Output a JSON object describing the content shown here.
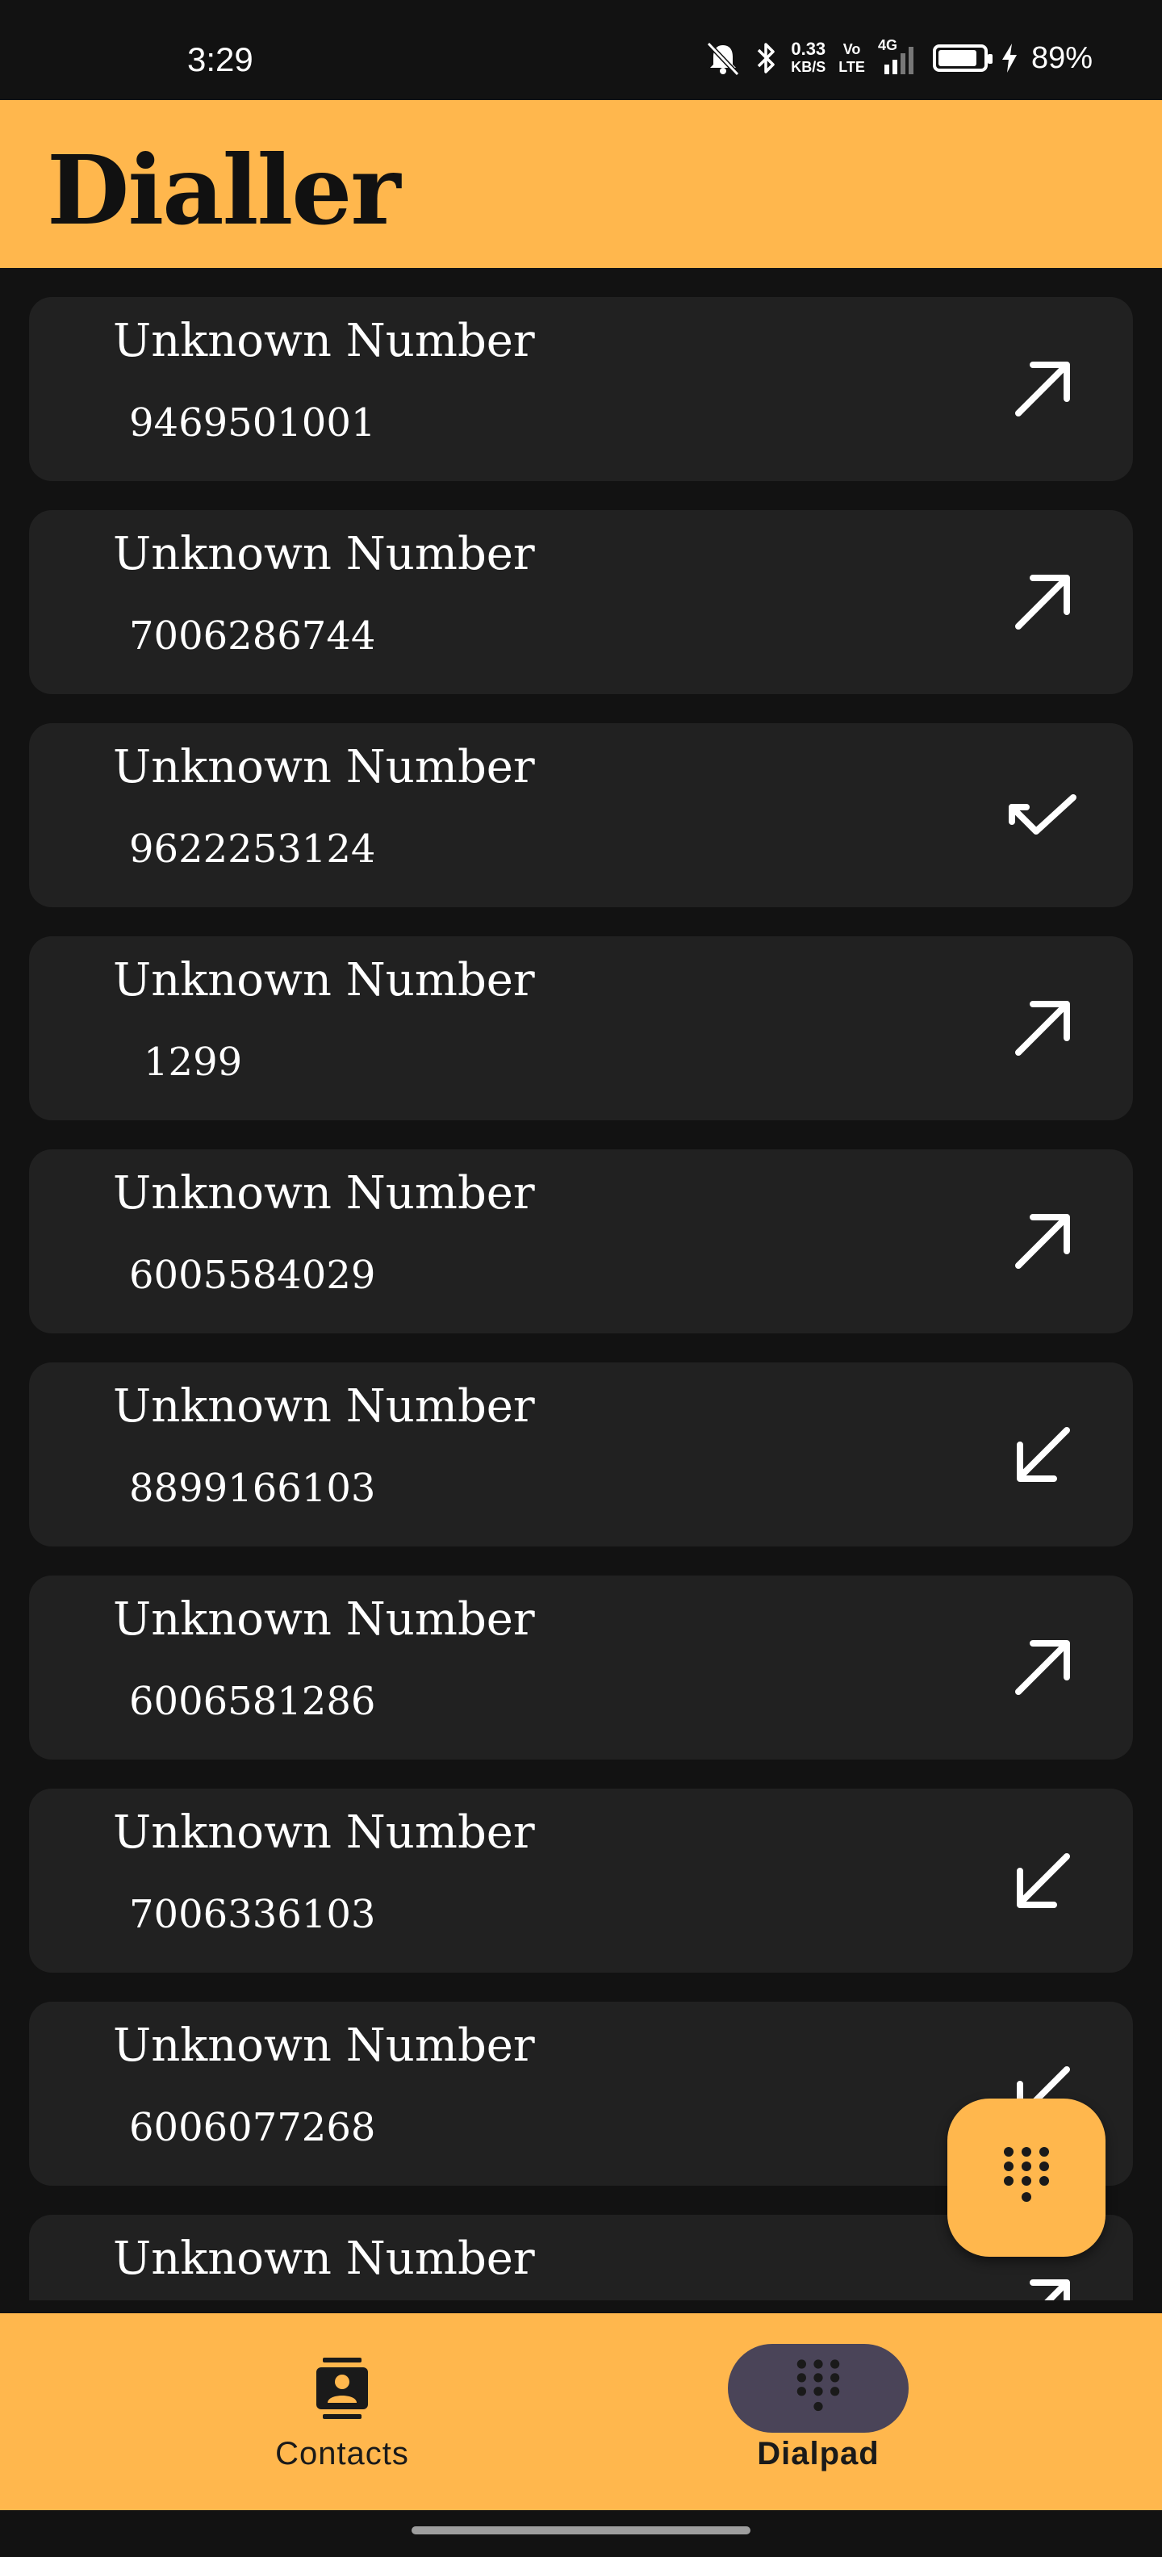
{
  "status_bar": {
    "time": "3:29",
    "net_speed_value": "0.33",
    "net_speed_unit": "KB/S",
    "volte_top": "Vo",
    "volte_bottom": "LTE",
    "network": "4G",
    "battery_text": "89%",
    "battery_level_percent": 89
  },
  "app_bar": {
    "title": "Dialler"
  },
  "calls": [
    {
      "name": "Unknown Number",
      "number": "9469501001",
      "direction": "outgoing"
    },
    {
      "name": "Unknown Number",
      "number": "7006286744",
      "direction": "outgoing"
    },
    {
      "name": "Unknown Number",
      "number": "9622253124",
      "direction": "missed"
    },
    {
      "name": "Unknown Number",
      "number": "1299",
      "direction": "outgoing"
    },
    {
      "name": "Unknown Number",
      "number": "6005584029",
      "direction": "outgoing"
    },
    {
      "name": "Unknown Number",
      "number": "8899166103",
      "direction": "incoming"
    },
    {
      "name": "Unknown Number",
      "number": "6006581286",
      "direction": "outgoing"
    },
    {
      "name": "Unknown Number",
      "number": "7006336103",
      "direction": "incoming"
    },
    {
      "name": "Unknown Number",
      "number": "6006077268",
      "direction": "incoming"
    },
    {
      "name": "Unknown Number",
      "number": "",
      "direction": "outgoing"
    }
  ],
  "fab": {
    "icon": "dialpad-icon"
  },
  "bottom_nav": {
    "items": [
      {
        "label": "Contacts",
        "icon": "contacts-icon",
        "selected": false
      },
      {
        "label": "Dialpad",
        "icon": "dialpad-icon",
        "selected": true
      }
    ]
  },
  "colors": {
    "accent": "#FFB74D",
    "background": "#121212",
    "card": "#212121",
    "nav_indicator": "#4A4458"
  }
}
